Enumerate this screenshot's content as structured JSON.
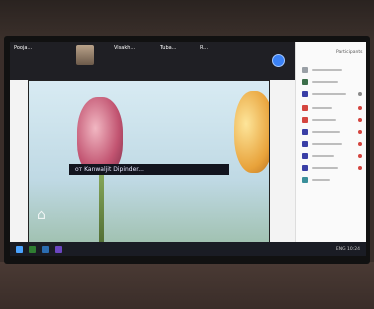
{
  "meeting": {
    "participants": [
      {
        "name": "Pooja...",
        "sub": ""
      },
      {
        "name": "",
        "sub": ""
      },
      {
        "name": "Visakh...",
        "sub": ""
      },
      {
        "name": "Tuba...",
        "sub": ""
      },
      {
        "name": "R...",
        "sub": ""
      }
    ]
  },
  "share": {
    "caption": "от Kanwaljit Dipinder..."
  },
  "panel": {
    "title": "Participants"
  },
  "taskbar": {
    "tray_text": "ENG  10:24"
  },
  "colors": {
    "accent": "#3b82f6",
    "panel_avatar_1": "#9aa0a6",
    "panel_avatar_2": "#3c6e4a",
    "panel_avatar_3": "#d4453f",
    "panel_avatar_4": "#3a3fa6"
  }
}
